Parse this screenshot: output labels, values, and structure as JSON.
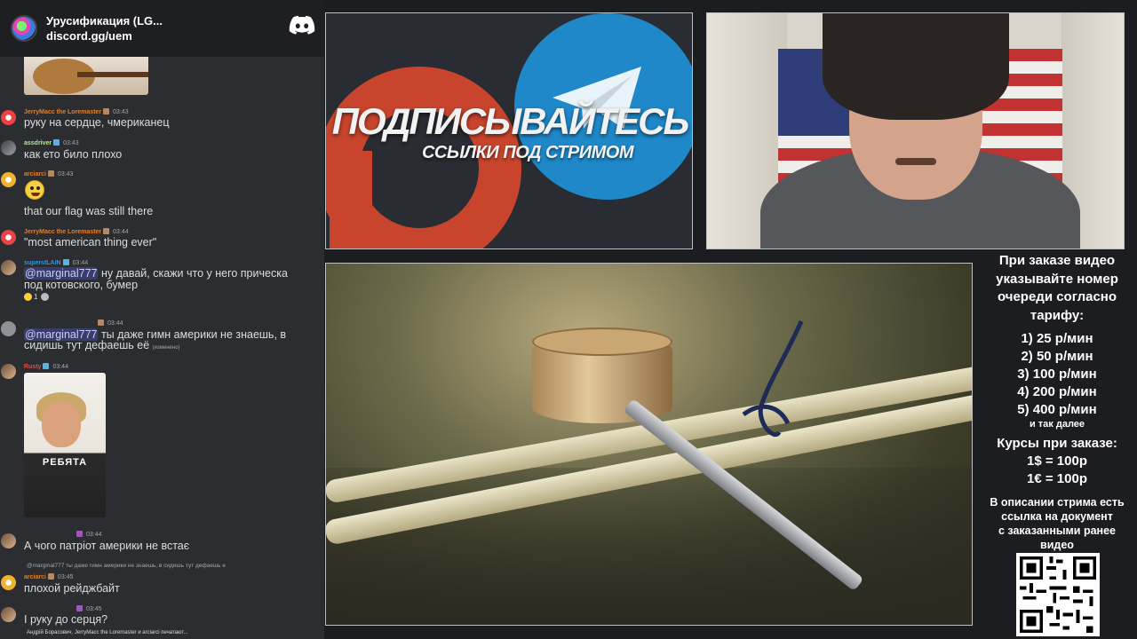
{
  "discord": {
    "server_name": "Урусификация (LG...",
    "server_link": "discord.gg/uem",
    "messages": [
      {
        "user": "JerryMacc the Loremaster",
        "time": "03:43",
        "text": "руку на сердце, чмериканец"
      },
      {
        "user": "assdriver",
        "time": "03:43",
        "text": "как ето било плохо"
      },
      {
        "user": "arciarci",
        "time": "03:43",
        "text": "that our flag was still there"
      },
      {
        "user": "JerryMacc the Loremaster",
        "time": "03:44",
        "text": "\"most american thing ever\""
      },
      {
        "user": "superstLAIN",
        "time": "03:44",
        "mention": "@marginal777",
        "text": " ну давай, скажи что у него прическа",
        "text2": "под котовского, бумер"
      },
      {
        "user": "",
        "time": "03:44",
        "mention": "@marginal777",
        "text": " ты даже гимн америки не знаешь, в",
        "text2": "сидишь тут дефаешь её",
        "edited": "(изменено)"
      },
      {
        "user": "Rusty",
        "time": "03:44",
        "image_caption": "РЕБЯТА"
      },
      {
        "user": "",
        "time": "03:44",
        "text": "А чого патріот америки не встає"
      },
      {
        "user": "arciarci",
        "time": "03:45",
        "reply": "@marginal777 ты даже гимн америки не знаешь, в сидишь тут дефаешь е",
        "text": "плохой рейджбайт"
      },
      {
        "user": "",
        "time": "03:45",
        "text": "І руку до серця?"
      }
    ],
    "reaction_count": "1",
    "typing_indicator": "Андрій Борасович, JerryMacc the Loremaster и arciarci печатают..."
  },
  "banner": {
    "title": "ПОДПИСЫВАЙТЕСЬ",
    "subtitle": "ССЫЛКИ ПОД СТРИМОМ"
  },
  "info_panel": {
    "head": [
      "При заказе видео",
      "указывайте номер",
      "очереди согласно",
      "тарифу:"
    ],
    "rates": [
      "1) 25 р/мин",
      "2) 50 р/мин",
      "3) 100 р/мин",
      "4) 200 р/мин",
      "5) 400 р/мин"
    ],
    "etc": "и так далее",
    "courses": [
      "Курсы при заказе:",
      "1$ = 100р",
      "1€ = 100р"
    ],
    "desc": [
      "В описании стрима есть",
      "ссылка на документ",
      "с заказанными ранее",
      "видео"
    ]
  },
  "colors": {
    "discord_bg": "#2b2d31",
    "discord_header": "#1e1f22",
    "patreon_red": "#c8442c",
    "telegram_blue": "#1f88c9"
  }
}
